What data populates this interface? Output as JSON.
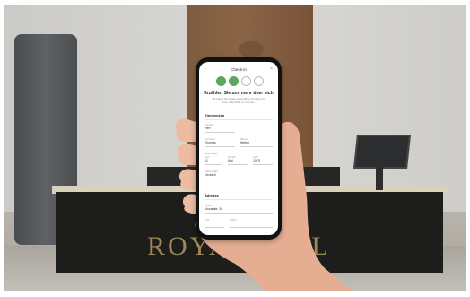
{
  "background": {
    "sign_left": "ROYA",
    "sign_right": "EL"
  },
  "app": {
    "title": "Check-in",
    "heading": "Erzählen Sie uns mehr über sich",
    "subtitle": "Wir bitten Sie einige persönliche Angaben für Ihren Aufenthalt zu machen.",
    "steps": [
      {
        "state": "done"
      },
      {
        "state": "done"
      },
      {
        "state": "off"
      },
      {
        "state": "off"
      }
    ],
    "section_personal": "Einchecken",
    "fields": {
      "salutation_label": "Anrede*",
      "salutation_value": "Herr",
      "firstname_label": "Vorname*",
      "firstname_value": "Thomas",
      "lastname_label": "Name*",
      "lastname_value": "Weber",
      "birth_label": "Geburtstag*",
      "birth_day_label": "Tag*",
      "birth_day_value": "01",
      "birth_month_label": "Monat*",
      "birth_month_value": "Mai",
      "birth_year_label": "Jahr*",
      "birth_year_value": "1975",
      "nationality_label": "Nationalität*",
      "nationality_value": "Deutsch"
    },
    "section_address": "Adresse",
    "address": {
      "street_label": "Straße*",
      "street_value": "Mozartstr. 26",
      "zip_label": "PLZ",
      "city_label": "Stadt*"
    }
  },
  "colors": {
    "step_done": "#5ba85b",
    "desk": "#1d1d1b",
    "logo_gold": "#9c8756"
  }
}
